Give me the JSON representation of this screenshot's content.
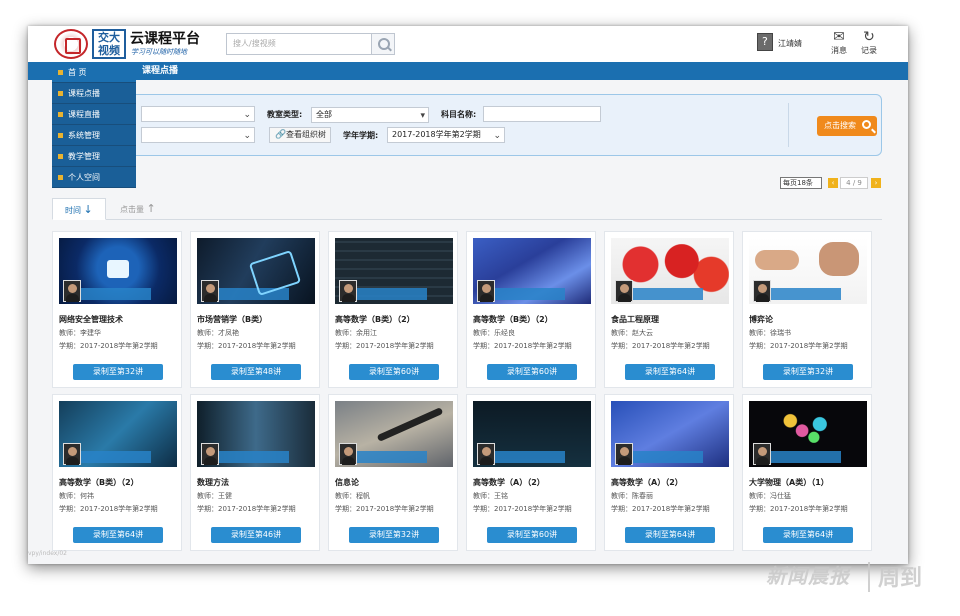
{
  "header": {
    "logo_text": "交大视频",
    "title": "云课程平台",
    "slogan": "学习可以随时随地",
    "search_placeholder": "搜人/搜视频",
    "user_name": "江靖婧",
    "messages_label": "消息",
    "records_label": "记录"
  },
  "nav": {
    "active_tab": "课程点播",
    "menu": [
      "首 页",
      "课程点播",
      "课程直播",
      "系统管理",
      "教学管理",
      "个人空间"
    ]
  },
  "filters": {
    "classroom_type_label": "教室类型:",
    "classroom_type_value": "全部",
    "subject_name_label": "科目名称:",
    "subject_name_value": "",
    "org_tree_button": "查看组织树",
    "term_label": "学年学期:",
    "term_value": "2017-2018学年第2学期",
    "search_button": "点击搜索"
  },
  "pager": {
    "per_page": "每页18条",
    "page_display": "4 / 9"
  },
  "sort": {
    "time_label": "时间",
    "clicks_label": "点击量"
  },
  "courses": [
    {
      "title": "网络安全管理技术",
      "teacher": "教师：李建华",
      "term": "学期：2017-2018学年第2学期",
      "record": "录制至第32讲",
      "art": "art-sec"
    },
    {
      "title": "市场营销学（B类）",
      "teacher": "教师：才凤艳",
      "term": "学期：2017-2018学年第2学期",
      "record": "录制至第48讲",
      "art": "art-mkt"
    },
    {
      "title": "高等数学（B类）（2）",
      "teacher": "教师：余用江",
      "term": "学期：2017-2018学年第2学期",
      "record": "录制至第60讲",
      "art": "art-math"
    },
    {
      "title": "高等数学（B类）（2）",
      "teacher": "教师：乐经良",
      "term": "学期：2017-2018学年第2学期",
      "record": "录制至第60讲",
      "art": "art-math2"
    },
    {
      "title": "食品工程原理",
      "teacher": "教师：赵大云",
      "term": "学期：2017-2018学年第2学期",
      "record": "录制至第64讲",
      "art": "art-food"
    },
    {
      "title": "博弈论",
      "teacher": "教师：徐瑞书",
      "term": "学期：2017-2018学年第2学期",
      "record": "录制至第32讲",
      "art": "art-game"
    },
    {
      "title": "高等数学（B类）（2）",
      "teacher": "教师：何祎",
      "term": "学期：2017-2018学年第2学期",
      "record": "录制至第64讲",
      "art": "art-blueg"
    },
    {
      "title": "数理方法",
      "teacher": "教师：王健",
      "term": "学期：2017-2018学年第2学期",
      "record": "录制至第46讲",
      "art": "art-tech"
    },
    {
      "title": "信息论",
      "teacher": "教师：程帆",
      "term": "学期：2017-2018学年第2学期",
      "record": "录制至第32讲",
      "art": "art-pen"
    },
    {
      "title": "高等数学（A）（2）",
      "teacher": "教师：王铭",
      "term": "学期：2017-2018学年第2学期",
      "record": "录制至第60讲",
      "art": "art-dark"
    },
    {
      "title": "高等数学（A）（2）",
      "teacher": "教师：陈春丽",
      "term": "学期：2017-2018学年第2学期",
      "record": "录制至第64讲",
      "art": "art-math3"
    },
    {
      "title": "大学物理（A类）（1）",
      "teacher": "教师：冯仕猛",
      "term": "学期：2017-2018学年第2学期",
      "record": "录制至第64讲",
      "art": "art-phys"
    }
  ],
  "url_hint": "vpy/index/02",
  "watermark": {
    "brand": "新闻晨报",
    "sub": "周到"
  }
}
